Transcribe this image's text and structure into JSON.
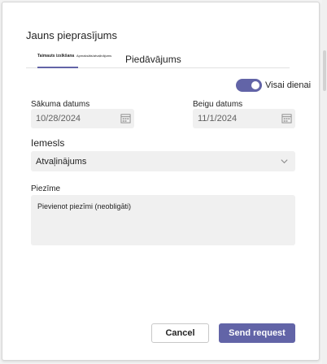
{
  "dialog": {
    "title": "Jauns pieprasījums",
    "tabs": [
      {
        "label": "Taimauts izsīkšana"
      },
      {
        "label": "Apmaksāts/atvaļinājums"
      },
      {
        "label": "Piedāvājums"
      }
    ],
    "all_day_toggle": {
      "label": "Visai dienai",
      "on": true
    },
    "start_date": {
      "label": "Sākuma datums",
      "value": "10/28/2024"
    },
    "end_date": {
      "label": "Beigu datums",
      "value": "11/1/2024"
    },
    "reason": {
      "label": "Iemesls",
      "value": "Atvaļinājums"
    },
    "note": {
      "label": "Piezīme",
      "placeholder": "Pievienot piezīmi (neobligāti)"
    },
    "buttons": {
      "cancel": "Cancel",
      "send": "Send request"
    }
  },
  "colors": {
    "accent": "#6264a7",
    "field_bg": "#f0f0f0"
  },
  "icons": {
    "date": "calendar-icon",
    "select": "chevron-down-icon",
    "toggle": "toggle-switch"
  }
}
